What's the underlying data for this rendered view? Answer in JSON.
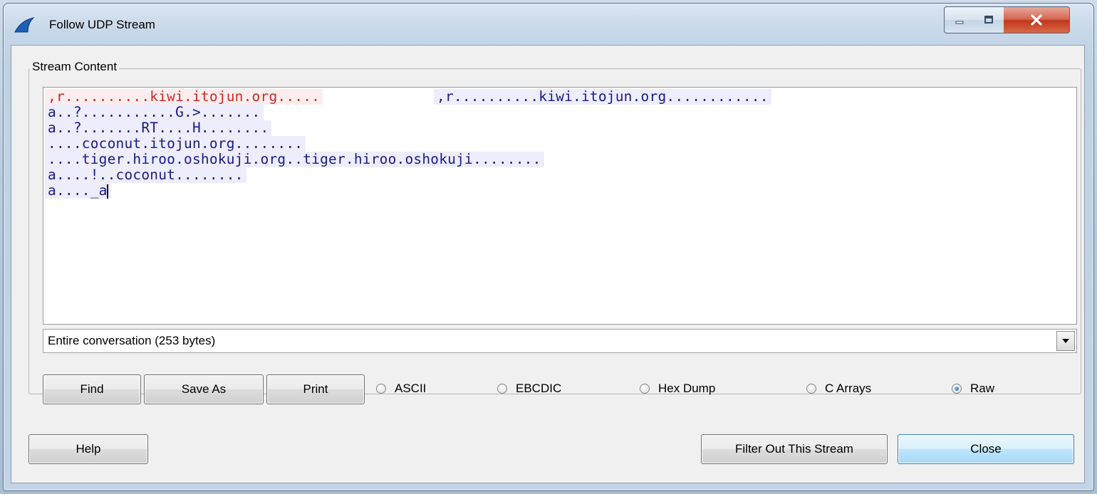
{
  "window": {
    "title": "Follow UDP Stream",
    "controls": {
      "minimize": "minimize",
      "maximize": "maximize",
      "close": "close"
    }
  },
  "group": {
    "label": "Stream Content"
  },
  "stream": {
    "lines": [
      {
        "dir": "client",
        "text": ",r..........kiwi.itojun.org....."
      },
      {
        "dir": "server",
        "text": ",r..........kiwi.itojun.org............"
      },
      {
        "dir": "server",
        "text": "a..?...........G.>......."
      },
      {
        "dir": "server",
        "text": "a..?.......RT....H........"
      },
      {
        "dir": "server",
        "text": "....coconut.itojun.org........"
      },
      {
        "dir": "server",
        "text": "....tiger.hiroo.oshokuji.org..tiger.hiroo.oshokuji........"
      },
      {
        "dir": "server",
        "text": "a....!..coconut........"
      },
      {
        "dir": "server",
        "text": "a...._a"
      }
    ]
  },
  "conversation_select": {
    "value": "Entire conversation (253 bytes)"
  },
  "buttons": {
    "find": "Find",
    "save_as": "Save As",
    "print": "Print",
    "help": "Help",
    "filter_out": "Filter Out This Stream",
    "close": "Close"
  },
  "formats": [
    {
      "label": "ASCII",
      "checked": false
    },
    {
      "label": "EBCDIC",
      "checked": false
    },
    {
      "label": "Hex Dump",
      "checked": false
    },
    {
      "label": "C Arrays",
      "checked": false
    },
    {
      "label": "Raw",
      "checked": true
    }
  ],
  "colors": {
    "client": "#cc2a2a",
    "server": "#1a1a8a",
    "client_bg": "#fbeded",
    "server_bg": "#ededfb"
  },
  "icons": {
    "app": "shark-fin-icon",
    "dropdown": "chevron-down-icon"
  }
}
